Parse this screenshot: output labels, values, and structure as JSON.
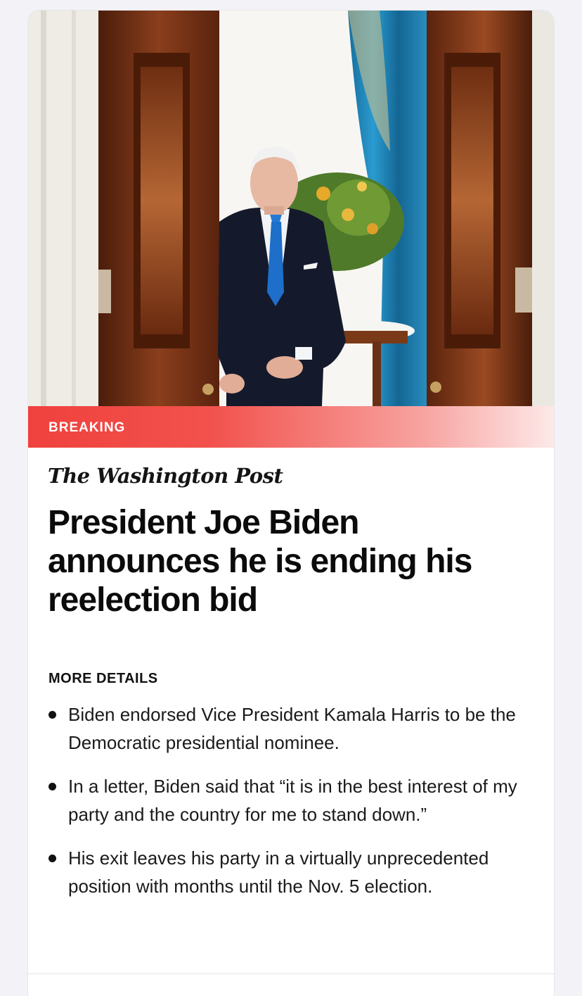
{
  "card": {
    "label": "BREAKING",
    "publisher": "The Washington Post",
    "headline": "President Joe Biden announces he is ending his reelection bid",
    "details_title": "MORE DETAILS",
    "details": [
      "Biden endorsed Vice President Kamala Harris to be the Democratic presidential nominee.",
      "In a letter, Biden said that “it is in the best interest of my party and the country for me to stand down.”",
      "His exit leaves his party in a virtually unprecedented position with months until the Nov. 5 election."
    ]
  },
  "colors": {
    "banner": "#f0413d",
    "drapes": "#1f86b8",
    "doors": "#7a3517"
  }
}
